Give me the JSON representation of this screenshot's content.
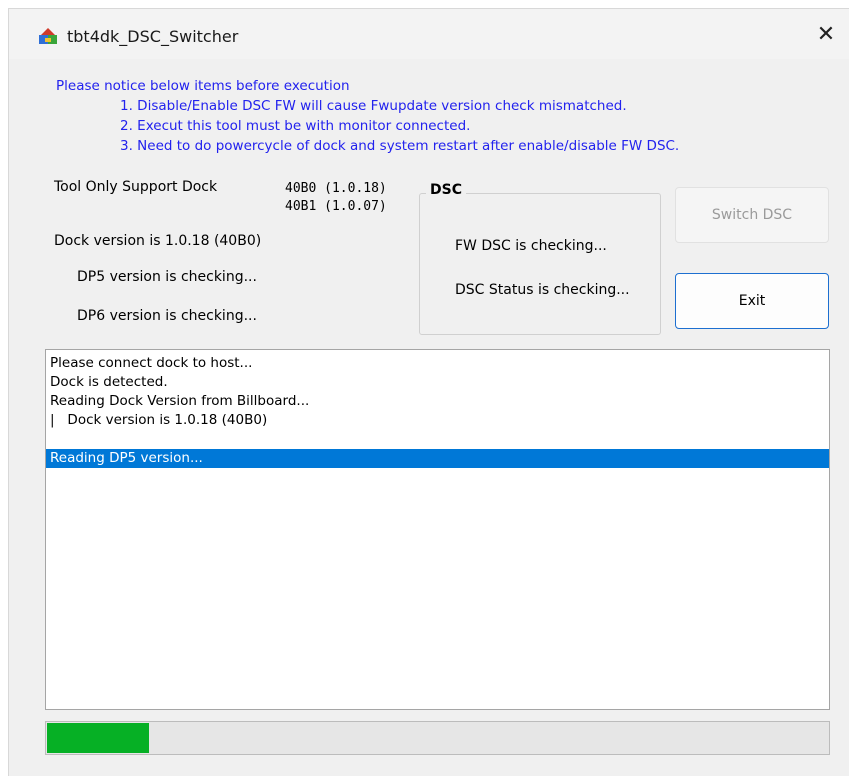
{
  "window": {
    "title": "tbt4dk_DSC_Switcher",
    "close_glyph": "✕"
  },
  "notice": {
    "heading": "Please notice below items before execution",
    "items": [
      "1. Disable/Enable DSC FW will cause Fwupdate version check mismatched.",
      "2. Execut this tool must be with monitor connected.",
      "3. Need to do powercycle of dock and system restart after enable/disable FW DSC."
    ],
    "color": "#2222ee"
  },
  "info": {
    "support_label": "Tool Only Support Dock",
    "supported_versions": [
      "40B0 (1.0.18)",
      "40B1 (1.0.07)"
    ],
    "dock_version": "Dock version is 1.0.18 (40B0)",
    "dp5_status": "DP5 version is checking...",
    "dp6_status": "DP6 version is checking..."
  },
  "dsc": {
    "group_label": "DSC",
    "fw_status": "FW DSC is checking...",
    "dsc_status": "DSC Status is checking..."
  },
  "buttons": {
    "switch_label": "Switch DSC",
    "exit_label": "Exit"
  },
  "log": {
    "lines": [
      "Please connect dock to host...",
      "Dock is detected.",
      "Reading Dock Version from Billboard...",
      "|   Dock version is 1.0.18 (40B0)",
      "",
      "Reading DP5 version..."
    ],
    "selected_index": 5,
    "selection_color": "#0078d7"
  },
  "progress": {
    "fraction": 0.13,
    "color": "#06b025"
  }
}
